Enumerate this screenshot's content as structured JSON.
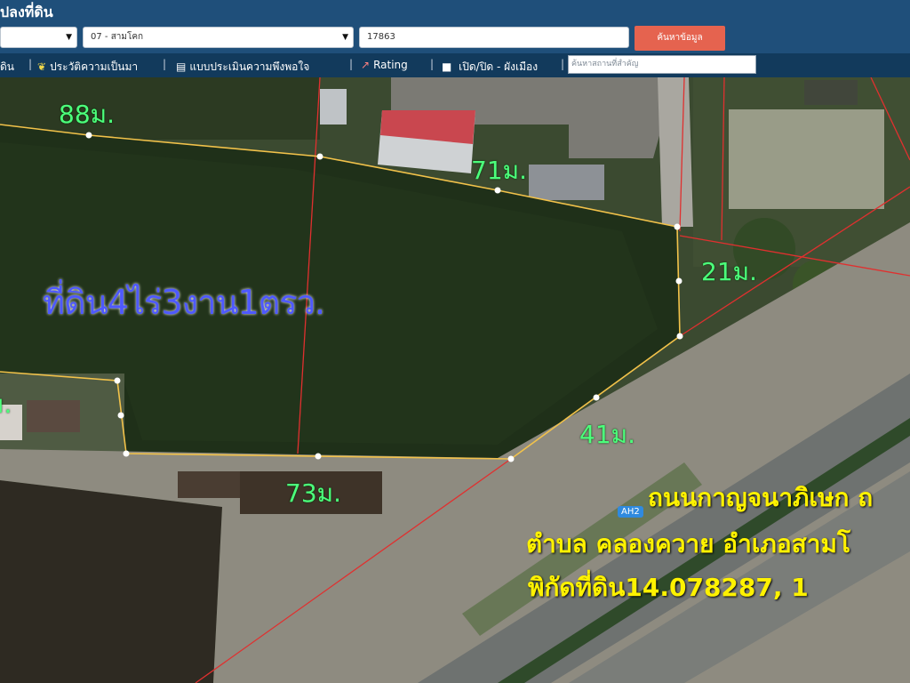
{
  "header": {
    "title": "ปลงที่ดิน",
    "select1_value": "",
    "select2_value": "07 - สามโคก",
    "parcel_input_value": "17863",
    "search_button_label": "ค้นหาข้อมูล"
  },
  "toolbar": {
    "items": [
      "ดิน",
      "ประวัติความเป็นมา",
      "แบบประเมินความพึงพอใจ",
      "Rating",
      "เปิด/ปิด - ผังเมือง"
    ],
    "landmark_placeholder": "ค้นหาสถานที่สำคัญ"
  },
  "map": {
    "area_label": "ที่ดิน4ไร่3งาน1ตรว.",
    "dimensions": {
      "top_left": "88ม.",
      "top_right": "71ม.",
      "right": "21ม.",
      "diagonal": "41ม.",
      "bottom": "73ม.",
      "left": "ม."
    },
    "road_line1": "ถนนกาญจนาภิเษก ถ",
    "road_line2": "ตำบล คลองควาย อำเภอสามโ",
    "road_line3": "พิกัดที่ดิน14.078287, 1",
    "highway_shield": "AH2"
  },
  "colors": {
    "header_bg": "#1f4f7a",
    "toolbar_bg": "#123a5c",
    "search_button": "#e5634f",
    "dimension_text": "#4cff7c",
    "area_text": "#4e59ff",
    "road_text": "#fff200",
    "parcel_line": "#f2c24a"
  }
}
